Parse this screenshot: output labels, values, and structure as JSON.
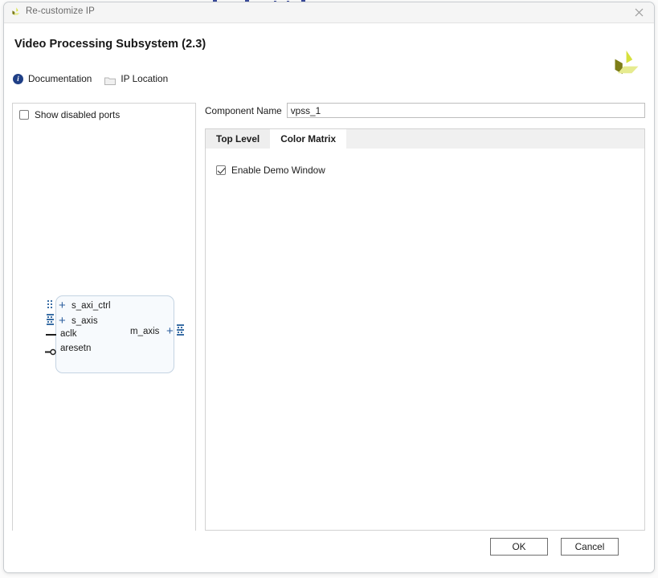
{
  "window": {
    "title": "Re-customize IP",
    "app_icon": "xilinx-logo-icon",
    "close_label": "×"
  },
  "header": {
    "title": "Video Processing Subsystem (2.3)",
    "brand_logo": "xilinx-pinwheel-logo",
    "links": [
      {
        "label": "Documentation",
        "icon": "info-circle-icon",
        "glyph": "i"
      },
      {
        "label": "IP Location",
        "icon": "folder-icon"
      }
    ]
  },
  "left_pane": {
    "show_disabled_ports": {
      "label": "Show disabled ports",
      "checked": false
    },
    "ip_symbol": {
      "input_ports": [
        {
          "name": "s_axi_ctrl",
          "type": "bus"
        },
        {
          "name": "s_axis",
          "type": "bus"
        },
        {
          "name": "aclk",
          "type": "clock"
        },
        {
          "name": "aresetn",
          "type": "reset-active-low"
        }
      ],
      "output_ports": [
        {
          "name": "m_axis",
          "type": "bus"
        }
      ]
    }
  },
  "right_pane": {
    "component_name": {
      "label": "Component Name",
      "value": "vpss_1",
      "placeholder": ""
    },
    "tabs": [
      {
        "label": "Top Level",
        "active": false
      },
      {
        "label": "Color Matrix",
        "active": true
      }
    ],
    "panel": {
      "enable_demo_window": {
        "label": "Enable Demo Window",
        "checked": true
      }
    }
  },
  "footer": {
    "ok_label": "OK",
    "cancel_label": "Cancel"
  },
  "colors": {
    "accent_blue": "#1f3f86",
    "port_blue": "#2d5f9e",
    "logo_yellow": "#d6e03c",
    "logo_olive": "#7d7d17",
    "dialog_bg": "#ffffff",
    "titlebar_bg": "#f5f5f5"
  }
}
